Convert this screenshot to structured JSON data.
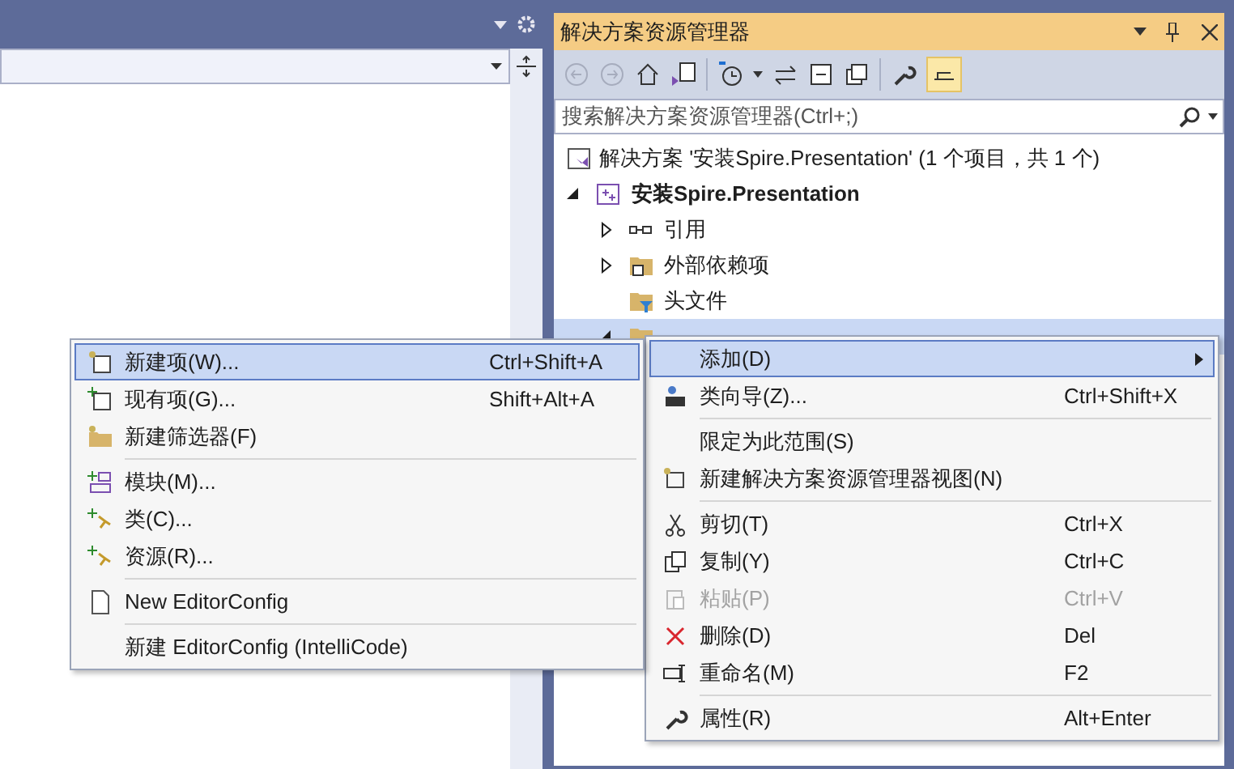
{
  "solution_explorer": {
    "title": "解决方案资源管理器",
    "search": {
      "placeholder": "搜索解决方案资源管理器(Ctrl+;)"
    },
    "tree": [
      {
        "label": "解决方案 '安装Spire.Presentation' (1 个项目，共 1 个)",
        "children": [
          {
            "label": "安装Spire.Presentation",
            "expanded": true,
            "children": [
              {
                "label": "引用",
                "expanded": false,
                "selected": false
              },
              {
                "label": "外部依赖项",
                "expanded": false,
                "selected": false
              },
              {
                "label": "头文件",
                "selected": false
              },
              {
                "selected": true,
                "expanded": true
              }
            ]
          }
        ]
      }
    ]
  },
  "context_menu": [
    {
      "label": "添加(D)",
      "submenu": true,
      "selected": true,
      "disabled": false
    },
    {
      "label": "类向导(Z)...",
      "shortcut": "Ctrl+Shift+X",
      "selected": false,
      "disabled": false
    },
    {
      "kind": "separator"
    },
    {
      "label": "限定为此范围(S)",
      "selected": false,
      "disabled": false
    },
    {
      "label": "新建解决方案资源管理器视图(N)",
      "selected": false,
      "disabled": false
    },
    {
      "kind": "separator"
    },
    {
      "label": "剪切(T)",
      "shortcut": "Ctrl+X",
      "selected": false,
      "disabled": false
    },
    {
      "label": "复制(Y)",
      "shortcut": "Ctrl+C",
      "selected": false,
      "disabled": false
    },
    {
      "label": "粘贴(P)",
      "shortcut": "Ctrl+V",
      "selected": false,
      "disabled": true
    },
    {
      "label": "删除(D)",
      "shortcut": "Del",
      "selected": false,
      "disabled": false
    },
    {
      "label": "重命名(M)",
      "shortcut": "F2",
      "selected": false,
      "disabled": false
    },
    {
      "kind": "separator"
    },
    {
      "label": "属性(R)",
      "shortcut": "Alt+Enter",
      "selected": false,
      "disabled": false
    }
  ],
  "submenu": [
    {
      "label": "新建项(W)...",
      "shortcut": "Ctrl+Shift+A",
      "selected": true,
      "disabled": false
    },
    {
      "label": "现有项(G)...",
      "shortcut": "Shift+Alt+A",
      "selected": false,
      "disabled": false
    },
    {
      "label": "新建筛选器(F)",
      "selected": false,
      "disabled": false
    },
    {
      "kind": "separator"
    },
    {
      "label": "模块(M)...",
      "selected": false,
      "disabled": false
    },
    {
      "label": "类(C)...",
      "selected": false,
      "disabled": false
    },
    {
      "label": "资源(R)...",
      "selected": false,
      "disabled": false
    },
    {
      "kind": "separator"
    },
    {
      "label": "New EditorConfig",
      "selected": false,
      "disabled": false
    },
    {
      "kind": "separator"
    },
    {
      "label": "新建 EditorConfig (IntelliCode)",
      "selected": false,
      "disabled": false
    }
  ]
}
